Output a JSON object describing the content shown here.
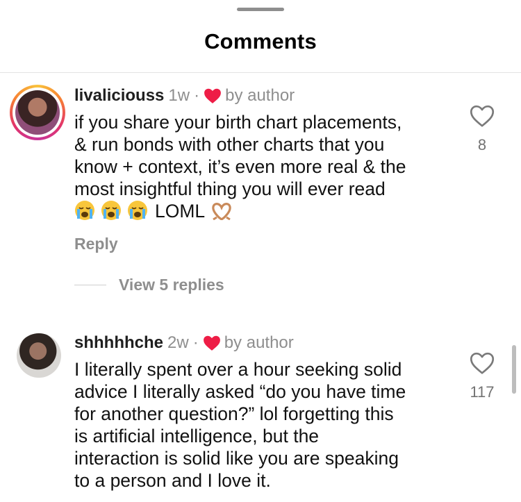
{
  "sheet": {
    "title": "Comments"
  },
  "comments": [
    {
      "username": "livaliciouss",
      "time": "1w",
      "separator": "·",
      "author_badge": "by author",
      "text": "if you share your birth chart placements,\n& run bonds with other charts that you\nknow + context, it’s even more real & the\nmost insightful thing you will ever read",
      "text_tail": "LOML",
      "emojis": [
        "loudly-crying-face",
        "loudly-crying-face",
        "loudly-crying-face",
        "heart-hands"
      ],
      "reply_label": "Reply",
      "view_replies": "View 5 replies",
      "likes": "8"
    },
    {
      "username": "shhhhhche",
      "time": "2w",
      "separator": "·",
      "author_badge": "by author",
      "text": "I literally spent over a hour seeking solid\nadvice I literally asked “do you have time\nfor another question?” lol forgetting this\nis artificial intelligence, but the\ninteraction is solid like you are speaking\nto a person and I love it.",
      "likes": "117"
    }
  ],
  "colors": {
    "author_heart": "#ee1d46",
    "secondary_text": "#8e8e8e",
    "ring_gradient": [
      "#f9c33b",
      "#f77f34",
      "#e2336b",
      "#c7359a"
    ]
  },
  "icons": {
    "like": "heart-outline-icon",
    "author_like": "heart-filled-icon"
  }
}
